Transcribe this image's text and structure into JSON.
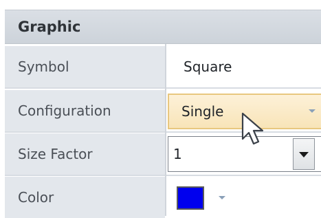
{
  "panel": {
    "section_title": "Graphic",
    "rows": [
      {
        "label": "Symbol",
        "value": "Square"
      },
      {
        "label": "Configuration",
        "value": "Single"
      },
      {
        "label": "Size Factor",
        "value": "1"
      },
      {
        "label": "Color",
        "value": ""
      }
    ],
    "color_value_hex": "#0000EE",
    "accent_highlight_hex": "#F8E4B8"
  }
}
